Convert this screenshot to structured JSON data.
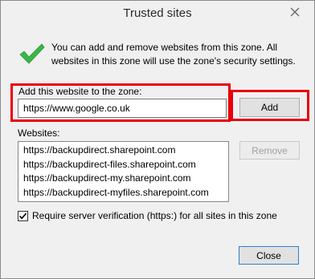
{
  "window": {
    "title": "Trusted sites"
  },
  "intro_text": "You can add and remove websites from this zone. All websites in this zone will use the zone's security settings.",
  "add_section": {
    "label": "Add this website to the zone:",
    "url_value": "https://www.google.co.uk",
    "add_label": "Add"
  },
  "websites": {
    "label": "Websites:",
    "items": [
      "https://backupdirect.sharepoint.com",
      "https://backupdirect-files.sharepoint.com",
      "https://backupdirect-my.sharepoint.com",
      "https://backupdirect-myfiles.sharepoint.com"
    ],
    "remove_label": "Remove"
  },
  "require_verification": {
    "label": "Require server verification (https:) for all sites in this zone",
    "checked": true
  },
  "close_label": "Close",
  "colors": {
    "highlight": "#e8000b",
    "check_green": "#3bb54a"
  },
  "icons": {
    "status": "checkmark-icon",
    "window_close": "close-icon"
  }
}
